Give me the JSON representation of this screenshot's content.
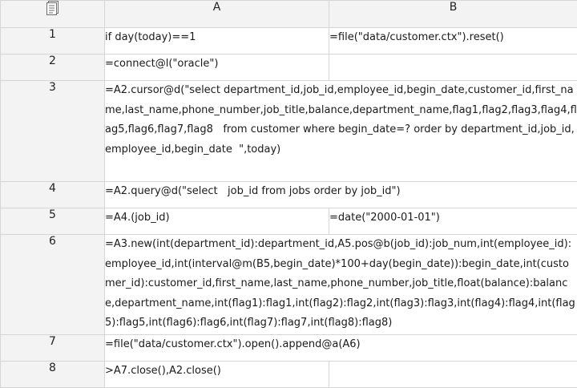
{
  "columns": [
    {
      "label": "A"
    },
    {
      "label": "B"
    }
  ],
  "rows": [
    {
      "num": "1",
      "a": "if day(today)==1",
      "b": "=file(\"data/customer.ctx\").reset()"
    },
    {
      "num": "2",
      "a": "=connect@l(\"oracle\")",
      "b": ""
    },
    {
      "num": "3",
      "a": "=A2.cursor@d(\"select department_id,job_id,employee_id,begin_date,customer_id,first_name,last_name,phone_number,job_title,balance,department_name,flag1,flag2,flag3,flag4,flag5,flag6,flag7,flag8   from customer where begin_date=? order by department_id,job_id,employee_id,begin_date  \",today)",
      "b": null
    },
    {
      "num": "4",
      "a": "=A2.query@d(\"select   job_id from jobs order by job_id\")",
      "b": null
    },
    {
      "num": "5",
      "a": "=A4.(job_id)",
      "b": "=date(\"2000-01-01\")"
    },
    {
      "num": "6",
      "a": "=A3.new(int(department_id):department_id,A5.pos@b(job_id):job_num,int(employee_id):employee_id,int(interval@m(B5,begin_date)*100+day(begin_date)):begin_date,int(customer_id):customer_id,first_name,last_name,phone_number,job_title,float(balance):balance,department_name,int(flag1):flag1,int(flag2):flag2,int(flag3):flag3,int(flag4):flag4,int(flag5):flag5,int(flag6):flag6,int(flag7):flag7,int(flag8):flag8)",
      "b": null
    },
    {
      "num": "7",
      "a": "=file(\"data/customer.ctx\").open().append@a(A6)",
      "b": null
    },
    {
      "num": "8",
      "a": ">A7.close(),A2.close()",
      "b": ""
    }
  ],
  "icons": {
    "corner": "sheet-icon"
  }
}
